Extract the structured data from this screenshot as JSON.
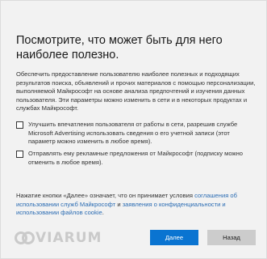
{
  "page": {
    "title": "Посмотрите, что может быть для него наиболее полезно.",
    "intro": "Обеспечить предоставление пользователю наиболее полезных и подходящих результатов поиска, объявлений и прочих материалов с помощью персонализации, выполняемой Майкрософт на основе анализа предпочтений и изучения данных пользователя. Эти параметры можно изменить в сети и в некоторых продуктах и службах Майкрософт."
  },
  "options": [
    {
      "label": "Улучшить впечатления пользователя от работы в сети, разрешив службе Microsoft Advertising использовать сведения о его учетной записи (этот параметр можно изменить в любое время).",
      "checked": false
    },
    {
      "label": "Отправлять ему рекламные предложения от Майкрософт (подписку можно отменить в любое время).",
      "checked": false
    }
  ],
  "footnote": {
    "text_1": "Нажатие кнопки «Далее» означает, что он принимает условия ",
    "link_services": "соглашения об использовании служб Майкрософт",
    "text_2": " и ",
    "link_privacy": "заявления о конфиденциальности и использовании файлов cookie",
    "text_3": "."
  },
  "watermark": {
    "text": "VIARUM"
  },
  "buttons": {
    "next_label": "Далее",
    "back_label": "Назад"
  },
  "colors": {
    "primary_button": "#0a74d1",
    "secondary_button": "#cccccc",
    "link": "#2b6cb3"
  }
}
